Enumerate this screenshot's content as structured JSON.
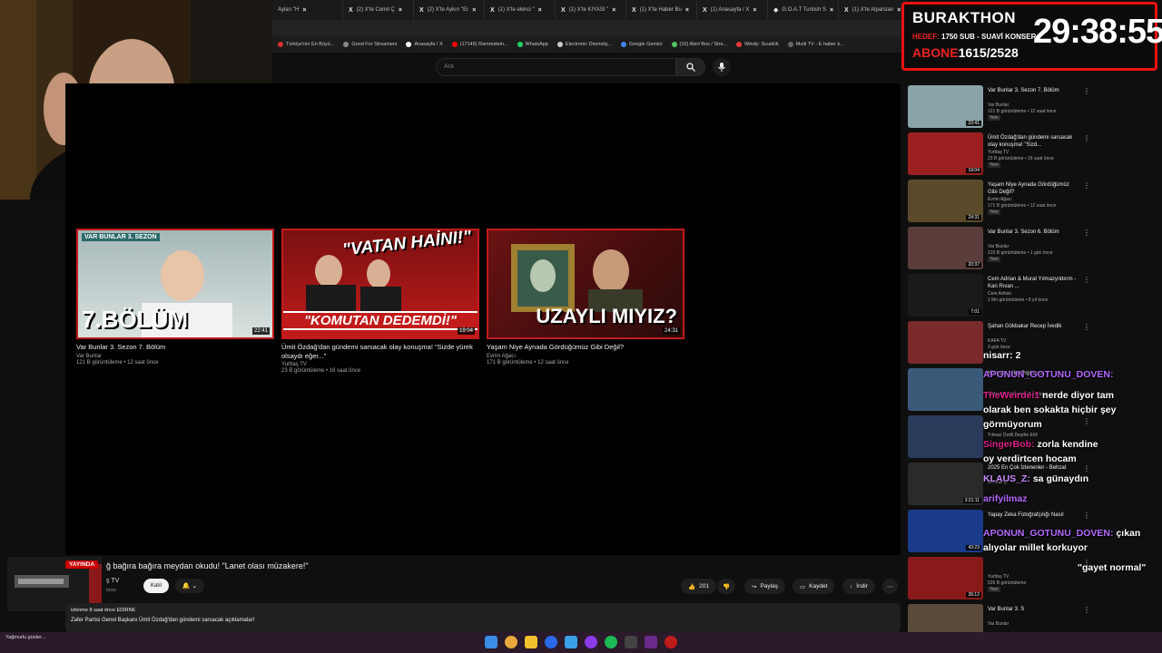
{
  "browser": {
    "tabs": [
      {
        "label": "Ayları \"H"
      },
      {
        "label": "(2) X'te Cemil Ç"
      },
      {
        "label": "(2) X'te Aykırı \"Er"
      },
      {
        "label": "(1) X'te ekinci \""
      },
      {
        "label": "(1) X'te KIYASI \""
      },
      {
        "label": "(1) X'te Haber Bu"
      },
      {
        "label": "(1) Anasayfa / X"
      },
      {
        "label": "G.O.A.T Turkish S"
      },
      {
        "label": "(1) X'te Alparslan"
      }
    ],
    "bookmarks": [
      {
        "label": "Türkiye'nin En Büyü...",
        "color": "#d32f2f"
      },
      {
        "label": "Good For Streamers",
        "color": "#888888"
      },
      {
        "label": "Anasayfa / X",
        "color": "#ffffff"
      },
      {
        "label": "(17145) Rammstein...",
        "color": "#ff0000"
      },
      {
        "label": "WhatsApp",
        "color": "#25d366"
      },
      {
        "label": "Electronic Diversity...",
        "color": "#cccccc"
      },
      {
        "label": "Google Gemini",
        "color": "#4285f4"
      },
      {
        "label": "(10) Alert Box / Stre...",
        "color": "#53c461"
      },
      {
        "label": "Windy: Sıcaklık",
        "color": "#e53935"
      },
      {
        "label": "Multi TV - E haber k...",
        "color": "#666666"
      }
    ]
  },
  "youtube": {
    "search_placeholder": "Ara",
    "end_cards": [
      {
        "title": "Var Bunlar 3. Sezon 7. Bölüm",
        "channel": "Var Bunlar",
        "meta": "121 B görüntüleme • 12 saat önce",
        "duration": "22:41",
        "thumb_text": "7.BÖLÜM",
        "thumb_tag": "VAR BUNLAR  3. SEZON"
      },
      {
        "title": "Ümit Özdağ'dan gündemi sarsacak olay konuşma! \"Sizde yürek olsaydı eğer...\"",
        "channel": "Yurttaş TV",
        "meta": "23 B görüntüleme • 16 saat önce",
        "duration": "19:04",
        "thumb_text": "\"KOMUTAN DEDEMDİ!\"",
        "thumb_tag": "\"VATAN HAİNİ!\""
      },
      {
        "title": "Yaşam Niye Aynada Gördüğümüz Gibi Değil?",
        "channel": "Evrim Ağacı",
        "meta": "171 B görüntüleme • 12 saat önce",
        "duration": "24:31",
        "thumb_text": "UZAYLI MIYIZ?"
      }
    ],
    "video_title": "ğ bağıra bağıra meydan okudu! \"Lanet olası müzakere!\"",
    "channel_name": "ş TV",
    "channel_subs": "bone",
    "join_label": "Katıl",
    "likes": "201",
    "share_label": "Paylaş",
    "save_label": "Kaydet",
    "download_label": "İndir",
    "desc_line1": "izlenme  8 saat önce  EDİRNE",
    "desc_line2": "Zafer Partisi Genel Başkanı Ümit Özdağ'dan gündemi sarsacak açıklamalar!",
    "live_badge": "YAYINDA"
  },
  "overlay": {
    "name": "BURAKTHON",
    "line_label": "HEDEF:",
    "line_text": "1750 SUB - SUAVİ KONSER",
    "sub_label": "ABONE",
    "sub_count": "1615/2528",
    "timer": "29:38:55"
  },
  "sidebar": [
    {
      "title": "Var Bunlar 3. Sezon 7. Bölüm",
      "channel": "Var Bunlar",
      "meta": "121 B görüntüleme • 12 saat önce",
      "badge": "Yeni",
      "duration": "22:41",
      "color": "#8aa3a8"
    },
    {
      "title": "Ümit Özdağ'dan gündemi sarsacak olay konuşma! \"Sizd...",
      "channel": "Yurttaş TV",
      "meta": "23 B görüntüleme • 16 saat önce",
      "badge": "Yeni",
      "duration": "19:04",
      "color": "#9c1f1f"
    },
    {
      "title": "Yaşam Niye Aynada Gördüğümüz Gibi Değil?",
      "channel": "Evrim Ağacı",
      "meta": "171 B görüntüleme • 12 saat önce",
      "badge": "Yeni",
      "duration": "24:31",
      "color": "#5b4a2a"
    },
    {
      "title": "Var Bunlar 3. Sezon 6. Bölüm",
      "channel": "Var Bunlar",
      "meta": "215 B görüntüleme • 1 gün önce",
      "badge": "Yeni",
      "duration": "20:37",
      "color": "#5a3d3a"
    },
    {
      "title": "Cem Adrian & Murat Yılmazyıldırım - Kan Rıvan ...",
      "channel": "Cem Adrian",
      "meta": "1 Mn görüntüleme • 8 yıl önce",
      "badge": "",
      "duration": "7:01",
      "color": "#1a1a1a"
    },
    {
      "title": "Şahan Gökbakar Recep İvedik",
      "channel": "KAFA TV",
      "meta": "3 gün önce",
      "badge": "",
      "duration": "",
      "color": "#7a2a2a"
    },
    {
      "title": "Kürsch - Like Orpheus",
      "channel": "",
      "meta": "1 Mn görüntüleme • 8 yıl önce",
      "badge": "",
      "duration": "",
      "color": "#3a5a7a"
    },
    {
      "title": "",
      "channel": "Yılmaz Özdil Deşifre Etti!",
      "meta": "",
      "badge": "",
      "duration": "",
      "color": "#2a3a5a"
    },
    {
      "title": "2025 En Çok İzlenenler - Behzat",
      "channel": "Behzat Ç.",
      "meta": "",
      "badge": "",
      "duration": "3:21:11",
      "color": "#2a2a2a"
    },
    {
      "title": "Yapay Zeka Fotoğrafçılığı Nasıl",
      "channel": "",
      "meta": "",
      "badge": "",
      "duration": "43:23",
      "color": "#1a3a8a"
    },
    {
      "title": "",
      "channel": "Yurttaş TV",
      "meta": "526 B görüntüleme",
      "badge": "Yeni",
      "duration": "26:12",
      "color": "#8a1a1a"
    },
    {
      "title": "Var Bunlar 3. S",
      "channel": "Var Bunlar",
      "meta": "",
      "badge": "",
      "duration": "",
      "color": "#5a4a3a"
    }
  ],
  "chat": [
    {
      "user": "",
      "msg": "nisarr: 2"
    },
    {
      "user": "APONUN_GOTUNU_DOVEN:",
      "msg": ""
    },
    {
      "user": "TheWeirdei1",
      "msg": "nerde diyor tam"
    },
    {
      "user": "",
      "msg": "olarak ben sokakta hiçbir şey"
    },
    {
      "user": "",
      "msg": "görmüyorum"
    },
    {
      "user": "SingerBob:",
      "msg": "zorla kendine"
    },
    {
      "user": "",
      "msg": "oy verdirtcen hocam"
    },
    {
      "user": "KLAUS_Z:",
      "msg": "sa günaydın"
    },
    {
      "user": "arifyilmaz",
      "msg": ""
    },
    {
      "user": "APONUN_GOTUNU_DOVEN:",
      "msg": "çıkan"
    },
    {
      "user": "",
      "msg": "alıyolar millet korkuyor"
    },
    {
      "user": "",
      "msg": "\"gayet normal\""
    }
  ],
  "taskbar": {
    "weather": "Yağmurlu günler..."
  }
}
